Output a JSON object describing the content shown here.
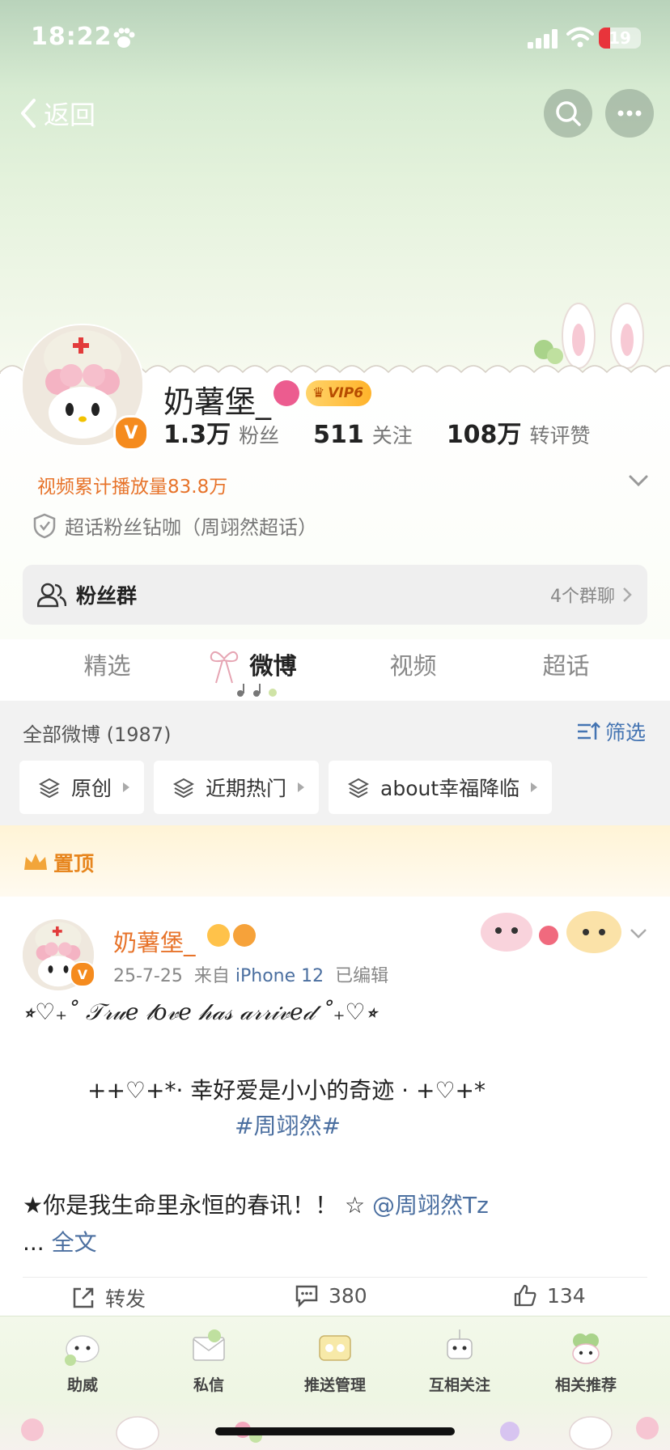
{
  "status_bar": {
    "time": "18:22",
    "battery": "19"
  },
  "header": {
    "back_label": "返回"
  },
  "profile": {
    "name": "奶薯堡_",
    "vip": "VIP6",
    "stats": [
      {
        "value": "1.3万",
        "label": "粉丝"
      },
      {
        "value": "511",
        "label": "关注"
      },
      {
        "value": "108万",
        "label": "转评赞"
      }
    ],
    "video_plays": "视频累计播放量83.8万",
    "supertopic": "超话粉丝钻咖（周翊然超话）"
  },
  "fans_group": {
    "title": "粉丝群",
    "count": "4个群聊"
  },
  "tabs": [
    "精选",
    "微博",
    "视频",
    "超话"
  ],
  "filters": {
    "all_posts": "全部微博 (1987)",
    "filter_label": "筛选",
    "chips": [
      "原创",
      "近期热门",
      "about幸福降临"
    ]
  },
  "pinned": {
    "label": "置顶"
  },
  "post": {
    "author": "奶薯堡_",
    "date": "25-7-25",
    "from": "来自",
    "device": "iPhone 12",
    "edited": "已编辑",
    "line1": "⭒♡₊˚ 𝒯𝓇𝓊𝑒 𝓁𝑜𝓋𝑒 𝒽𝒶𝓈 𝒶𝓇𝓇𝒾𝓋𝑒𝒹 ˚₊♡⭒",
    "line2": "++♡+*· 幸好爱是小小的奇迹 · +♡+*",
    "hashtag": "#周翊然#",
    "line3": "★你是我生命里永恒的春讯！！ ☆ ",
    "mention": "@周翊然Tz",
    "ellipsis": "... ",
    "fulltext": "全文",
    "actions": {
      "repost": "转发",
      "comments": "380",
      "likes": "134"
    }
  },
  "bottom_bar": [
    "助威",
    "私信",
    "推送管理",
    "互相关注",
    "相关推荐"
  ]
}
